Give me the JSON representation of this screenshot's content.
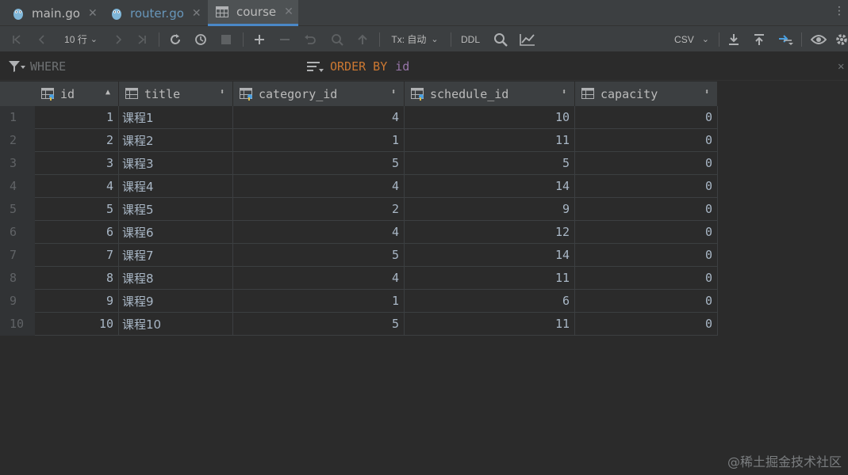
{
  "tabs": [
    {
      "label": "main.go",
      "icon": "go-file-icon",
      "active": false
    },
    {
      "label": "router.go",
      "icon": "go-file-icon",
      "active": false
    },
    {
      "label": "course",
      "icon": "table-icon",
      "active": true
    }
  ],
  "toolbar": {
    "page_size": "10 行",
    "tx_mode": "Tx: 自动",
    "ddl_label": "DDL",
    "export_format": "CSV"
  },
  "filter": {
    "where_placeholder": "WHERE",
    "order_keyword": "ORDER BY",
    "order_column": "id"
  },
  "table": {
    "columns": [
      {
        "name": "id",
        "sort": "▲"
      },
      {
        "name": "title",
        "sort": "⬍"
      },
      {
        "name": "category_id",
        "sort": "⬍"
      },
      {
        "name": "schedule_id",
        "sort": "⬍"
      },
      {
        "name": "capacity",
        "sort": "⬍"
      }
    ],
    "rows": [
      {
        "n": "1",
        "id": "1",
        "title": "课程1",
        "category_id": "4",
        "schedule_id": "10",
        "capacity": "0"
      },
      {
        "n": "2",
        "id": "2",
        "title": "课程2",
        "category_id": "1",
        "schedule_id": "11",
        "capacity": "0"
      },
      {
        "n": "3",
        "id": "3",
        "title": "课程3",
        "category_id": "5",
        "schedule_id": "5",
        "capacity": "0"
      },
      {
        "n": "4",
        "id": "4",
        "title": "课程4",
        "category_id": "4",
        "schedule_id": "14",
        "capacity": "0"
      },
      {
        "n": "5",
        "id": "5",
        "title": "课程5",
        "category_id": "2",
        "schedule_id": "9",
        "capacity": "0"
      },
      {
        "n": "6",
        "id": "6",
        "title": "课程6",
        "category_id": "4",
        "schedule_id": "12",
        "capacity": "0"
      },
      {
        "n": "7",
        "id": "7",
        "title": "课程7",
        "category_id": "5",
        "schedule_id": "14",
        "capacity": "0"
      },
      {
        "n": "8",
        "id": "8",
        "title": "课程8",
        "category_id": "4",
        "schedule_id": "11",
        "capacity": "0"
      },
      {
        "n": "9",
        "id": "9",
        "title": "课程9",
        "category_id": "1",
        "schedule_id": "6",
        "capacity": "0"
      },
      {
        "n": "10",
        "id": "10",
        "title": "课程10",
        "category_id": "5",
        "schedule_id": "11",
        "capacity": "0"
      }
    ]
  },
  "watermark": "@稀土掘金技术社区",
  "colors": {
    "background": "#2b2b2b",
    "panel": "#3c3f41",
    "keyword": "#cc7832",
    "column_ref": "#9876aa",
    "active_tab_underline": "#4a88c7"
  }
}
